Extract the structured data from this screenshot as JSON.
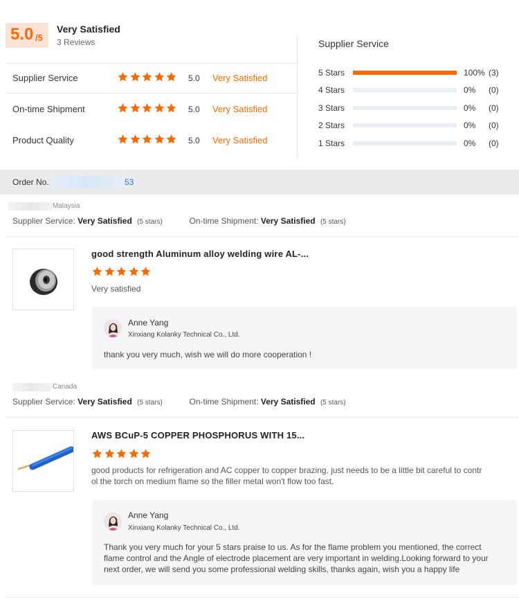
{
  "summary": {
    "score": "5.0",
    "score_max": "/5",
    "title": "Very Satisfied",
    "reviews": "3 Reviews",
    "ratings": [
      {
        "label": "Supplier Service",
        "value": "5.0",
        "text": "Very Satisfied",
        "stars": 5
      },
      {
        "label": "On-time Shipment",
        "value": "5.0",
        "text": "Very Satisfied",
        "stars": 5
      },
      {
        "label": "Product Quality",
        "value": "5.0",
        "text": "Very Satisfied",
        "stars": 5
      }
    ],
    "colors": {
      "accent": "#ff6a00",
      "score_bg": "#fde3d6"
    }
  },
  "distribution": {
    "title": "Supplier Service",
    "rows": [
      {
        "label": "5  Stars",
        "pct": "100%",
        "count": "(3)",
        "fill": 1.0
      },
      {
        "label": "4  Stars",
        "pct": "0%",
        "count": "(0)",
        "fill": 0
      },
      {
        "label": "3  Stars",
        "pct": "0%",
        "count": "(0)",
        "fill": 0
      },
      {
        "label": "2  Stars",
        "pct": "0%",
        "count": "(0)",
        "fill": 0
      },
      {
        "label": "1  Stars",
        "pct": "0%",
        "count": "(0)",
        "fill": 0
      }
    ]
  },
  "order": {
    "label": "Order No.:",
    "number_tail": "53"
  },
  "reviews": [
    {
      "country": "Malaysia",
      "supplier_service_label": "Supplier Service:",
      "supplier_service_value": "Very Satisfied",
      "supplier_service_stars": "(5 stars)",
      "shipment_label": "On-time Shipment:",
      "shipment_value": "Very Satisfied",
      "shipment_stars": "(5 stars)",
      "product_title": "good strength Aluminum alloy welding wire AL-...",
      "stars": 5,
      "comment": "Very satisfied",
      "reply": {
        "name": "Anne Yang",
        "company": "Xinxiang Kolanky Technical Co., Ltd.",
        "text": "thank you very much, wish we will do more cooperation !"
      }
    },
    {
      "country": "Canada",
      "supplier_service_label": "Supplier Service:",
      "supplier_service_value": "Very Satisfied",
      "supplier_service_stars": "(5 stars)",
      "shipment_label": "On-time Shipment:",
      "shipment_value": "Very Satisfied",
      "shipment_stars": "(5 stars)",
      "product_title": "AWS BCuP-5 COPPER PHOSPHORUS WITH 15...",
      "stars": 5,
      "comment_line1": "good products for refrigeration and AC copper to copper brazing, just needs to be a little bit careful to contr",
      "comment_line2": "ol the torch on medium flame so the filler metal won't flow too fast.",
      "reply": {
        "name": "Anne Yang",
        "company": "Xinxiang Kolanky Technical Co., Ltd.",
        "text_line1": "Thank you very much for your 5 stars praise to us. As for the flame problem you mentioned, the correct",
        "text_line2": "flame control and the Angle of electrode placement are very important in welding.Looking forward to your",
        "text_line3": "next order, we will send you some professional welding skills, thanks again, wish you a happy life"
      }
    }
  ]
}
